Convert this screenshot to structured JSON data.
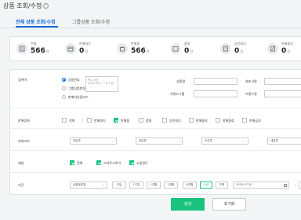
{
  "page": {
    "title": "상품 조회/수정",
    "help": "?"
  },
  "tabs": [
    {
      "label": "전체 상품 조회/수정",
      "active": true
    },
    {
      "label": "그룹상품 조회/수정",
      "active": false
    }
  ],
  "stats": [
    {
      "label": "전체",
      "value": "566",
      "unit": "건"
    },
    {
      "label": "판매대기",
      "value": "0",
      "unit": "건"
    },
    {
      "label": "판매중",
      "value": "566",
      "unit": "건"
    },
    {
      "label": "품절",
      "value": "0",
      "unit": "건"
    },
    {
      "label": "승인대기",
      "value": "0",
      "unit": "건"
    },
    {
      "label": "판매중지",
      "value": "0",
      "unit": "건"
    }
  ],
  "search": {
    "label": "검색어",
    "options": [
      "상품번호",
      "그룹상품번호",
      "판매자상품코드"
    ],
    "selected": 0,
    "textarea_placeholder": "복수 검색\n(enter 또는 \",\" 로 구분)",
    "fields": [
      "상품명",
      "제조사명",
      "키워드그룹",
      "브랜드명"
    ]
  },
  "status": {
    "label": "판매상태",
    "options": [
      {
        "label": "전체",
        "checked": false
      },
      {
        "label": "판매대기",
        "checked": false
      },
      {
        "label": "판매중",
        "checked": true
      },
      {
        "label": "품절",
        "checked": false
      },
      {
        "label": "승인대기",
        "checked": false
      },
      {
        "label": "판매중지",
        "checked": false
      },
      {
        "label": "판매종료",
        "checked": false
      },
      {
        "label": "판매금지",
        "checked": false
      }
    ]
  },
  "category": {
    "label": "카테고리",
    "selects": [
      "대분류",
      "중분류",
      "소분류",
      "세분류"
    ]
  },
  "channel": {
    "label": "채널",
    "options": [
      {
        "label": "전체",
        "checked": true
      },
      {
        "label": "스마트스토어",
        "checked": true
      },
      {
        "label": "쇼핑윈도",
        "checked": true
      }
    ]
  },
  "period": {
    "label": "기간",
    "type": "상품등록일",
    "buttons": [
      "오늘",
      "1주일",
      "1개월",
      "3개월",
      "6개월",
      "1년",
      "전체"
    ],
    "active": "1년",
    "date": "2024.07.30",
    "tilde": "~"
  },
  "actions": {
    "search": "검색",
    "reset": "초기화"
  },
  "colors": {
    "accent": "#19c37d",
    "tab": "#0b6bd5"
  }
}
